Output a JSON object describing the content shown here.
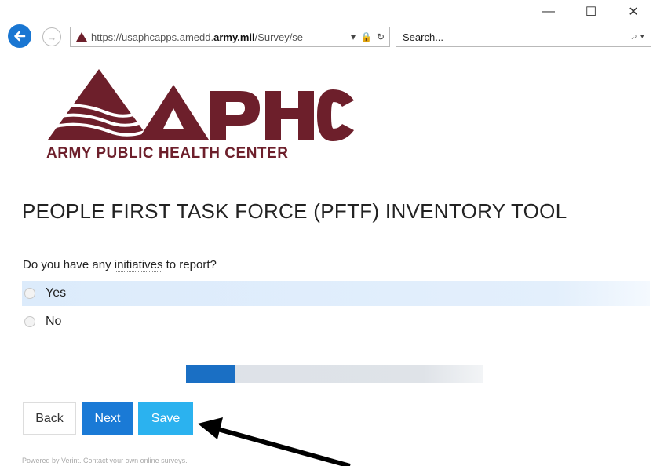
{
  "browser": {
    "url_prefix": "https://usaphcapps.amedd.",
    "url_domain": "army.mil",
    "url_suffix": "/Survey/se",
    "search_placeholder": "Search..."
  },
  "logo": {
    "name": "APHC",
    "subtitle": "ARMY PUBLIC HEALTH CENTER",
    "color": "#6d1f2b"
  },
  "page": {
    "title": "PEOPLE FIRST TASK FORCE (PFTF) INVENTORY TOOL"
  },
  "question": {
    "prefix": "Do you have any ",
    "term": "initiatives",
    "suffix": " to report?",
    "options": [
      "Yes",
      "No"
    ],
    "highlighted": "Yes"
  },
  "progress": {
    "fraction": 0.165
  },
  "buttons": {
    "back": "Back",
    "next": "Next",
    "save": "Save"
  },
  "footer": {
    "text": "Powered by Verint. Contact your own online surveys."
  },
  "colors": {
    "accent": "#1a7ad6",
    "save": "#2bb2ef",
    "progress_fill": "#1a6fc4",
    "highlight": "#dcebfb"
  }
}
